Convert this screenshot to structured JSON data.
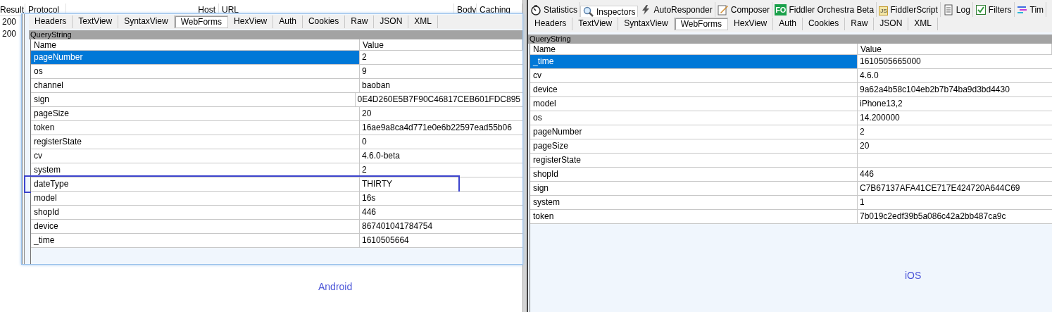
{
  "session_list": {
    "columns": [
      "Result",
      "Protocol",
      "Host",
      "URL",
      "Body",
      "Caching"
    ],
    "rows": [
      {
        "result": "200"
      },
      {
        "result": "200"
      }
    ]
  },
  "android_inspector": {
    "tabs": [
      {
        "label": "Headers",
        "selected": false
      },
      {
        "label": "TextView",
        "selected": false
      },
      {
        "label": "SyntaxView",
        "selected": false
      },
      {
        "label": "WebForms",
        "selected": true
      },
      {
        "label": "HexView",
        "selected": false
      },
      {
        "label": "Auth",
        "selected": false
      },
      {
        "label": "Cookies",
        "selected": false
      },
      {
        "label": "Raw",
        "selected": false
      },
      {
        "label": "JSON",
        "selected": false
      },
      {
        "label": "XML",
        "selected": false
      }
    ],
    "section_title": "QueryString",
    "columns": [
      "Name",
      "Value"
    ],
    "rows": [
      {
        "name": "pageNumber",
        "value": "2",
        "selected": true,
        "highlighted": false
      },
      {
        "name": "os",
        "value": "9",
        "selected": false,
        "highlighted": false
      },
      {
        "name": "channel",
        "value": "baoban",
        "selected": false,
        "highlighted": false
      },
      {
        "name": "sign",
        "value": "0E4D260E5B7F90C46817CEB601FDC895",
        "selected": false,
        "highlighted": false
      },
      {
        "name": "pageSize",
        "value": "20",
        "selected": false,
        "highlighted": false
      },
      {
        "name": "token",
        "value": "16ae9a8ca4d771e0e6b22597ead55b06",
        "selected": false,
        "highlighted": false
      },
      {
        "name": "registerState",
        "value": "0",
        "selected": false,
        "highlighted": false
      },
      {
        "name": "cv",
        "value": "4.6.0-beta",
        "selected": false,
        "highlighted": false
      },
      {
        "name": "system",
        "value": "2",
        "selected": false,
        "highlighted": false
      },
      {
        "name": "dateType",
        "value": "THIRTY",
        "selected": false,
        "highlighted": true
      },
      {
        "name": "model",
        "value": "16s",
        "selected": false,
        "highlighted": false
      },
      {
        "name": "shopId",
        "value": "446",
        "selected": false,
        "highlighted": false
      },
      {
        "name": "device",
        "value": "867401041784754",
        "selected": false,
        "highlighted": false
      },
      {
        "name": "_time",
        "value": "1610505664",
        "selected": false,
        "highlighted": false
      }
    ]
  },
  "android_caption": "Android",
  "ios_inspector": {
    "main_tabs": [
      {
        "label": "Statistics",
        "selected": false
      },
      {
        "label": "Inspectors",
        "selected": true
      },
      {
        "label": "AutoResponder",
        "selected": false
      },
      {
        "label": "Composer",
        "selected": false
      },
      {
        "label": "Fiddler Orchestra Beta",
        "badge": "FO",
        "selected": false
      },
      {
        "label": "FiddlerScript",
        "badge": "JS",
        "selected": false
      },
      {
        "label": "Log",
        "selected": false
      },
      {
        "label": "Filters",
        "selected": false
      },
      {
        "label": "Tim",
        "selected": false
      }
    ],
    "tabs": [
      {
        "label": "Headers",
        "selected": false
      },
      {
        "label": "TextView",
        "selected": false
      },
      {
        "label": "SyntaxView",
        "selected": false
      },
      {
        "label": "WebForms",
        "selected": true
      },
      {
        "label": "HexView",
        "selected": false
      },
      {
        "label": "Auth",
        "selected": false
      },
      {
        "label": "Cookies",
        "selected": false
      },
      {
        "label": "Raw",
        "selected": false
      },
      {
        "label": "JSON",
        "selected": false
      },
      {
        "label": "XML",
        "selected": false
      }
    ],
    "section_title": "QueryString",
    "columns": [
      "Name",
      "Value"
    ],
    "rows": [
      {
        "name": "_time",
        "value": "1610505665000",
        "selected": true
      },
      {
        "name": "cv",
        "value": "4.6.0",
        "selected": false
      },
      {
        "name": "device",
        "value": "9a62a4b58c104eb2b7b74ba9d3bd4430",
        "selected": false
      },
      {
        "name": "model",
        "value": "iPhone13,2",
        "selected": false
      },
      {
        "name": "os",
        "value": "14.200000",
        "selected": false
      },
      {
        "name": "pageNumber",
        "value": "2",
        "selected": false
      },
      {
        "name": "pageSize",
        "value": "20",
        "selected": false
      },
      {
        "name": "registerState",
        "selected": false
      },
      {
        "name": "shopId",
        "value": "446",
        "selected": false
      },
      {
        "name": "sign",
        "value": "C7B67137AFA41CE717E424720A644C69",
        "selected": false
      },
      {
        "name": "system",
        "value": "1",
        "selected": false
      },
      {
        "name": "token",
        "value": "7b019c2edf39b5a086c42a2bb487ca9c",
        "selected": false
      }
    ]
  },
  "ios_caption": "iOS"
}
